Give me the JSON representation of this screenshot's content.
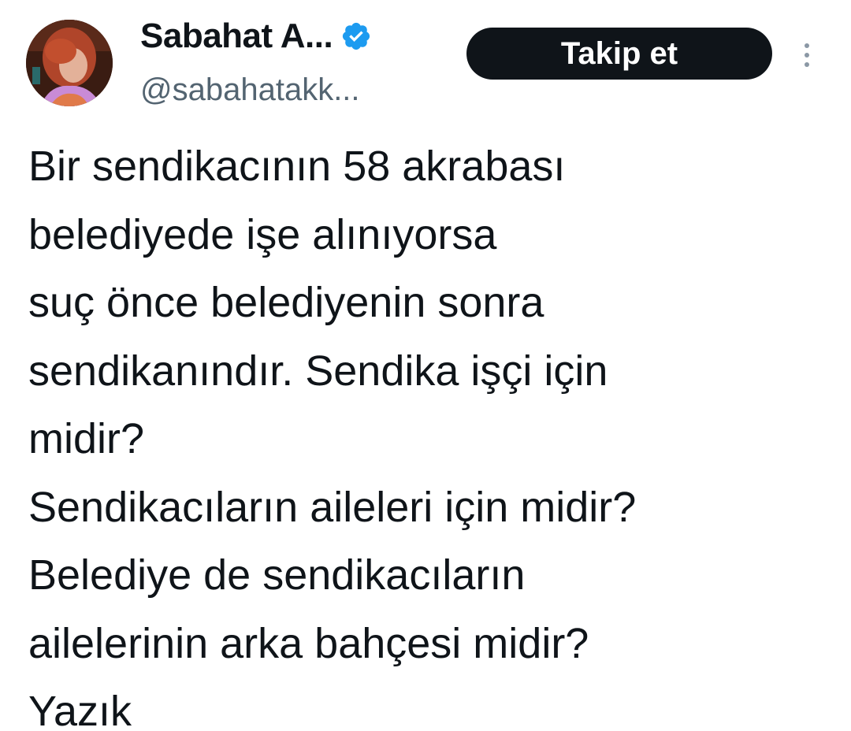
{
  "author": {
    "display_name": "Sabahat A...",
    "handle": "@sabahatakk...",
    "verified": true,
    "avatar_icon": "profile-photo"
  },
  "actions": {
    "follow_label": "Takip et",
    "more_icon": "more-vertical-icon"
  },
  "tweet": {
    "lines": [
      "Bir sendikacının 58 akrabası",
      "belediyede işe alınıyorsa",
      "suç önce belediyenin sonra",
      "sendikanındır. Sendika işçi için",
      "midir?",
      "Sendikacıların aileleri için midir?",
      "Belediye de sendikacıların",
      "ailelerinin arka bahçesi midir?",
      "Yazık"
    ]
  },
  "colors": {
    "text": "#0f1419",
    "secondary": "#536471",
    "verified_badge": "#1d9bf0",
    "button_bg": "#0f1419",
    "button_text": "#ffffff"
  }
}
